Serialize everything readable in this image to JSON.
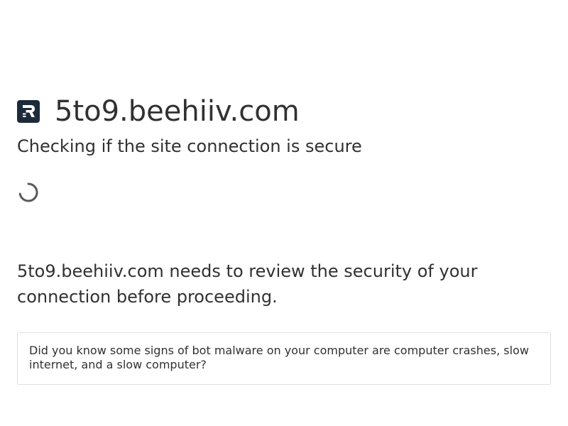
{
  "site": {
    "domain": "5to9.beehiiv.com",
    "favicon_icon": "beehiiv-logo-icon",
    "favicon_bg": "#1d2a3a"
  },
  "status": {
    "heading": "Checking if the site connection is secure",
    "spinner_icon": "loading-spinner-icon"
  },
  "message": {
    "text": "5to9.beehiiv.com needs to review the security of your connection before proceeding."
  },
  "tip": {
    "text": "Did you know some signs of bot malware on your computer are computer crashes, slow internet, and a slow computer?"
  },
  "colors": {
    "text": "#313131",
    "border": "#e0e0e0",
    "spinner": "#595959"
  }
}
